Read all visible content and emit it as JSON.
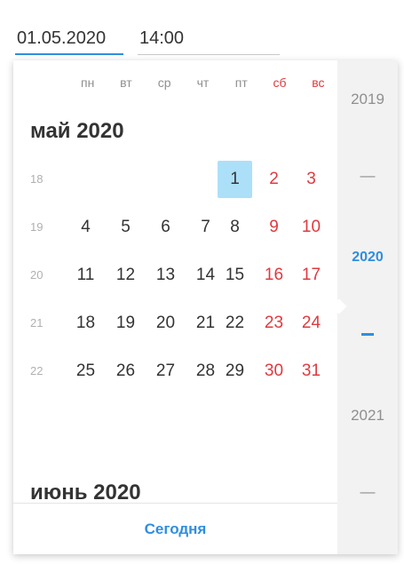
{
  "inputs": {
    "date_value": "01.05.2020",
    "time_value": "14:00"
  },
  "weekdays": [
    {
      "label": "пн",
      "weekend": false
    },
    {
      "label": "вт",
      "weekend": false
    },
    {
      "label": "ср",
      "weekend": false
    },
    {
      "label": "чт",
      "weekend": false
    },
    {
      "label": "пт",
      "weekend": false
    },
    {
      "label": "сб",
      "weekend": true
    },
    {
      "label": "вс",
      "weekend": true
    }
  ],
  "months": [
    {
      "title": "май 2020",
      "weeks": [
        {
          "number": "18",
          "days": [
            "",
            "",
            "",
            "",
            "1",
            "2",
            "3"
          ]
        },
        {
          "number": "19",
          "days": [
            "4",
            "5",
            "6",
            "7",
            "8",
            "9",
            "10"
          ]
        },
        {
          "number": "20",
          "days": [
            "11",
            "12",
            "13",
            "14",
            "15",
            "16",
            "17"
          ]
        },
        {
          "number": "21",
          "days": [
            "18",
            "19",
            "20",
            "21",
            "22",
            "23",
            "24"
          ]
        },
        {
          "number": "22",
          "days": [
            "25",
            "26",
            "27",
            "28",
            "29",
            "30",
            "31"
          ]
        }
      ]
    },
    {
      "title": "июнь 2020",
      "weeks": []
    }
  ],
  "selected_day": "1",
  "today_label": "Сегодня",
  "years": {
    "prev": "2019",
    "current": "2020",
    "next": "2021",
    "separator": "—"
  },
  "colors": {
    "accent": "#2f8ee0",
    "weekend": "#e0393e",
    "selected_bg": "#ace0f9"
  }
}
